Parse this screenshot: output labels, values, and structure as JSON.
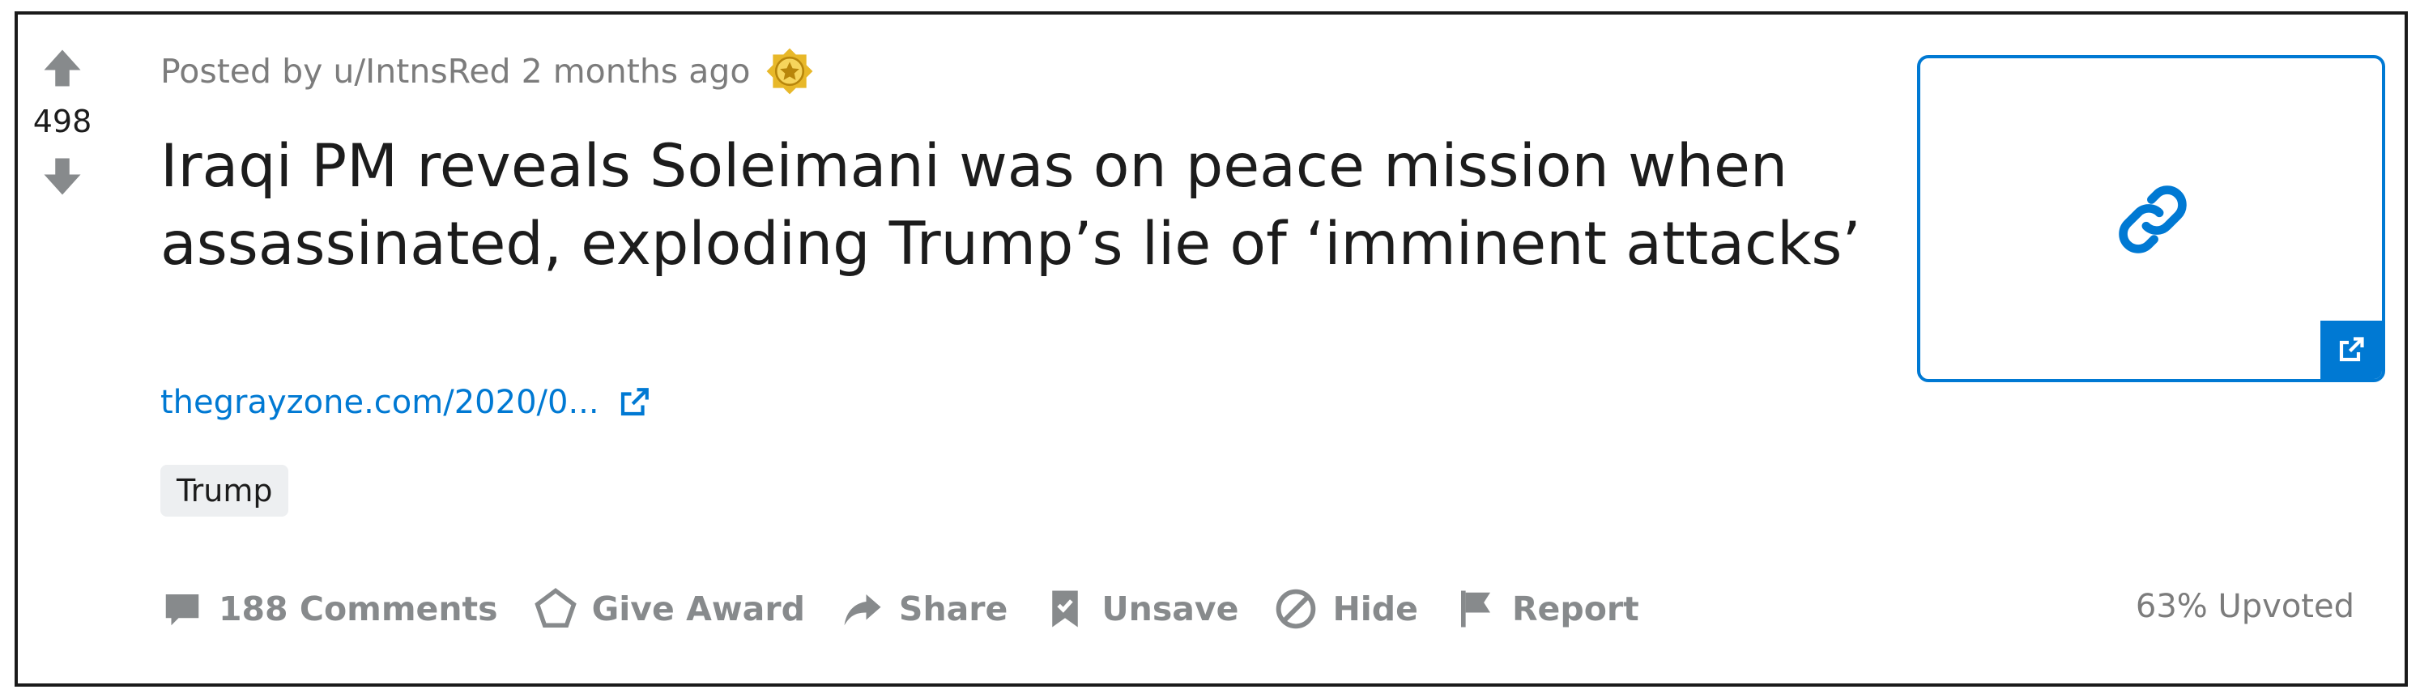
{
  "post": {
    "votes": "498",
    "meta": "Posted by u/IntnsRed 2 months ago",
    "title": "Iraqi PM reveals Soleimani was on peace mission when assassinated, exploding Trump’s lie of ‘imminent attacks’",
    "link_text": "thegrayzone.com/2020/0...",
    "flair": "Trump",
    "upvote_ratio": "63% Upvoted"
  },
  "actions": {
    "comments": "188 Comments",
    "award": "Give Award",
    "share": "Share",
    "unsave": "Unsave",
    "hide": "Hide",
    "report": "Report"
  },
  "icons": {
    "upvote": "arrow-up-icon",
    "downvote": "arrow-down-icon",
    "award": "award-badge-icon",
    "external": "external-link-icon",
    "link": "link-chain-icon",
    "comments": "comment-bubble-icon",
    "give_award": "award-icon",
    "share": "share-arrow-icon",
    "unsave": "bookmark-icon",
    "hide": "hide-icon",
    "report": "flag-icon"
  },
  "colors": {
    "accent": "#0079d3",
    "text": "#1c1c1c",
    "muted": "#878a8c",
    "flair_bg": "#edeff1"
  }
}
